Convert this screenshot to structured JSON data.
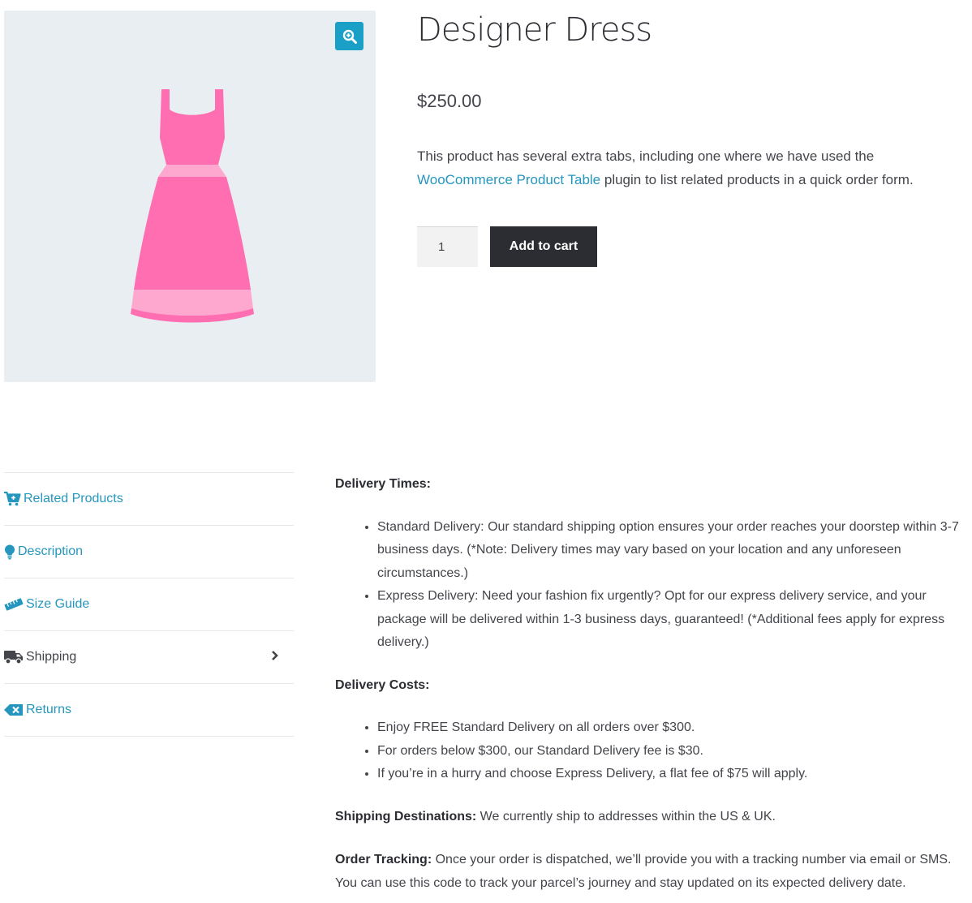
{
  "product": {
    "title": "Designer Dress",
    "price": "$250.00",
    "description_before_link": "This product has several extra tabs, including one where we have used the ",
    "description_link": "WooCommerce Product Table",
    "description_after_link": " plugin to list related products in a quick order form.",
    "quantity": "1",
    "add_to_cart_label": "Add to cart"
  },
  "gallery": {
    "zoom_icon": "zoom-in-icon",
    "image": "pink-dress"
  },
  "tabs": [
    {
      "label": "Related Products",
      "icon": "cart-plus-icon",
      "active": false
    },
    {
      "label": "Description",
      "icon": "lightbulb-icon",
      "active": false
    },
    {
      "label": "Size Guide",
      "icon": "ruler-icon",
      "active": false
    },
    {
      "label": "Shipping",
      "icon": "truck-icon",
      "active": true
    },
    {
      "label": "Returns",
      "icon": "backspace-icon",
      "active": false
    }
  ],
  "shipping_panel": {
    "delivery_times_heading": "Delivery Times:",
    "delivery_times_items": [
      "Standard Delivery: Our standard shipping option ensures your order reaches your doorstep within 3-7 business days. (*Note: Delivery times may vary based on your location and any unforeseen circumstances.)",
      "Express Delivery: Need your fashion fix urgently? Opt for our express delivery service, and your package will be delivered within 1-3 business days, guaranteed! (*Additional fees apply for express delivery.)"
    ],
    "delivery_costs_heading": "Delivery Costs:",
    "delivery_costs_items": [
      "Enjoy FREE Standard Delivery on all orders over $300.",
      "For orders below $300, our Standard Delivery fee is $30.",
      "If you’re in a hurry and choose Express Delivery, a flat fee of $75 will apply."
    ],
    "destinations_label": "Shipping Destinations:",
    "destinations_text": " We currently ship to addresses within the US & UK.",
    "tracking_label": "Order Tracking:",
    "tracking_text": " Once your order is dispatched, we’ll provide you with a tracking number via email or SMS. You can use this code to track your parcel’s journey and stay updated on its expected delivery date."
  },
  "colors": {
    "accent": "#2596be",
    "zoom_button": "#1aa0c7",
    "button_dark": "#2c2d33",
    "dress_pink": "#ff6eb0",
    "dress_light_pink": "#ffa8cf",
    "gallery_bg": "#e8eef2"
  }
}
